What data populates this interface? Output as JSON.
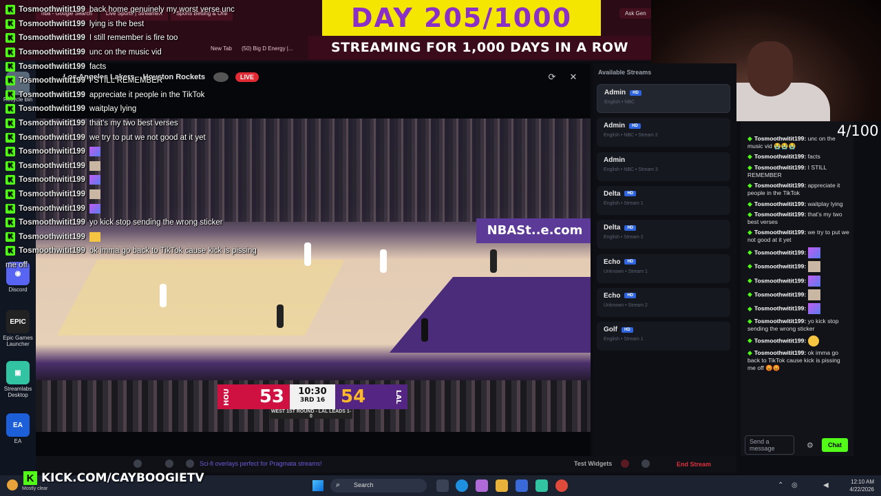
{
  "browser": {
    "tabs": [
      "nba - Google Search",
      "Live Sports | StreameX",
      "Sports Betting & Onli",
      "Ask Gen"
    ],
    "bookmarks": [
      "New Tab",
      "(50) Big D Energy |..."
    ]
  },
  "banner": {
    "day": "DAY 205/1000",
    "subtitle": "STREAMING FOR 1,000 DAYS IN A ROW"
  },
  "player": {
    "home_label": "Los Angeles Lakers",
    "away_label": "Houston Rockets",
    "live": "LIVE",
    "adboard": "NBASt..e.com",
    "scoreboard": {
      "hou_abbr": "HOU",
      "hou_score": "53",
      "clock": "10:30",
      "quarter": "3RD",
      "shot_clock": "16",
      "lal_score": "54",
      "lal_abbr": "LAL",
      "series": "WEST 1ST ROUND - LAL LEADS 1-0"
    }
  },
  "overlay_chat": [
    {
      "user": "Tosmoothwitit199",
      "msg": "back home genuinely my worst verse unc"
    },
    {
      "user": "Tosmoothwitit199",
      "msg": "lying is the best"
    },
    {
      "user": "Tosmoothwitit199",
      "msg": "I still remember is fire too"
    },
    {
      "user": "Tosmoothwitit199",
      "msg": "unc on the music vid"
    },
    {
      "user": "Tosmoothwitit199",
      "msg": "facts"
    },
    {
      "user": "Tosmoothwitit199",
      "msg": "I STILL REMEMBER"
    },
    {
      "user": "Tosmoothwitit199",
      "msg": "appreciate it people in the TikTok"
    },
    {
      "user": "Tosmoothwitit199",
      "msg": "waitplay lying"
    },
    {
      "user": "Tosmoothwitit199",
      "msg": "that's my two best verses"
    },
    {
      "user": "Tosmoothwitit199",
      "msg": "we try to put we not good at it yet"
    },
    {
      "user": "Tosmoothwitit199",
      "emote": "purple"
    },
    {
      "user": "Tosmoothwitit199",
      "emote": "face"
    },
    {
      "user": "Tosmoothwitit199",
      "emote": "purple"
    },
    {
      "user": "Tosmoothwitit199",
      "emote": "face"
    },
    {
      "user": "Tosmoothwitit199",
      "emote": "purple"
    },
    {
      "user": "Tosmoothwitit199",
      "msg": "yo kick stop sending the wrong sticker"
    },
    {
      "user": "Tosmoothwitit199",
      "emote": "yellow"
    },
    {
      "user": "Tosmoothwitit199",
      "msg": "ok imma go back to TikTok cause kick is pissing"
    },
    {
      "user": "",
      "msg": "me off"
    }
  ],
  "streams": {
    "title": "Available Streams",
    "items": [
      {
        "name": "Admin",
        "hd": "HD",
        "sub": "English • NBC",
        "active": true
      },
      {
        "name": "Admin",
        "hd": "HD",
        "sub": "English • NBC • Stream 2"
      },
      {
        "name": "Admin",
        "hd": "",
        "sub": "English • NBC • Stream 3"
      },
      {
        "name": "Delta",
        "hd": "HD",
        "sub": "English • Stream 1"
      },
      {
        "name": "Delta",
        "hd": "HD",
        "sub": "English • Stream 2"
      },
      {
        "name": "Echo",
        "hd": "HD",
        "sub": "Unknown • Stream 1"
      },
      {
        "name": "Echo",
        "hd": "HD",
        "sub": "Unknown • Stream 2"
      },
      {
        "name": "Golf",
        "hd": "HD",
        "sub": "English • Stream 1"
      }
    ]
  },
  "counter": "4/100",
  "chat": {
    "messages": [
      {
        "user": "Tosmoothwitit199:",
        "text": "unc on the music vid 😭😭😭"
      },
      {
        "user": "Tosmoothwitit199:",
        "text": "facts"
      },
      {
        "user": "Tosmoothwitit199:",
        "text": "I STILL REMEMBER"
      },
      {
        "user": "Tosmoothwitit199:",
        "text": "appreciate it people in the TikTok"
      },
      {
        "user": "Tosmoothwitit199:",
        "text": "waitplay lying"
      },
      {
        "user": "Tosmoothwitit199:",
        "text": "that's my two best verses"
      },
      {
        "user": "Tosmoothwitit199:",
        "text": "we try to put we not good at it yet"
      },
      {
        "user": "Tosmoothwitit199:",
        "emote": "purple"
      },
      {
        "user": "Tosmoothwitit199:",
        "emote": "face"
      },
      {
        "user": "Tosmoothwitit199:",
        "emote": "purple"
      },
      {
        "user": "Tosmoothwitit199:",
        "emote": "face"
      },
      {
        "user": "Tosmoothwitit199:",
        "emote": "purple"
      },
      {
        "user": "Tosmoothwitit199:",
        "text": "yo kick stop sending the wrong sticker"
      },
      {
        "user": "Tosmoothwitit199:",
        "emote": "yellow"
      },
      {
        "user": "Tosmoothwitit199:",
        "text": "ok imma go back to TikTok cause kick is pissing me off 😡😡"
      }
    ],
    "input_placeholder": "Send a message",
    "send_label": "Chat"
  },
  "studio": {
    "promo": "Sci-fi overlays perfect for Pragmata streams!",
    "test_widgets": "Test Widgets",
    "end_stream": "End Stream"
  },
  "kick_url": "KICK.COM/CAYBOOGIETV",
  "desktop_icons": [
    "Recycle Bin",
    "Discord",
    "Epic Games Launcher",
    "Streamlabs Desktop",
    "EA"
  ],
  "taskbar": {
    "weather": "Mostly clear",
    "search": "Search",
    "time": "12:10 AM",
    "date": "4/22/2026"
  },
  "colors": {
    "kick_green": "#53fc18",
    "banner_yellow": "#f5e600",
    "banner_purple": "#8b2fc9",
    "end_red": "#e0303c",
    "hou_red": "#ce1141",
    "lal_purple": "#552583"
  }
}
